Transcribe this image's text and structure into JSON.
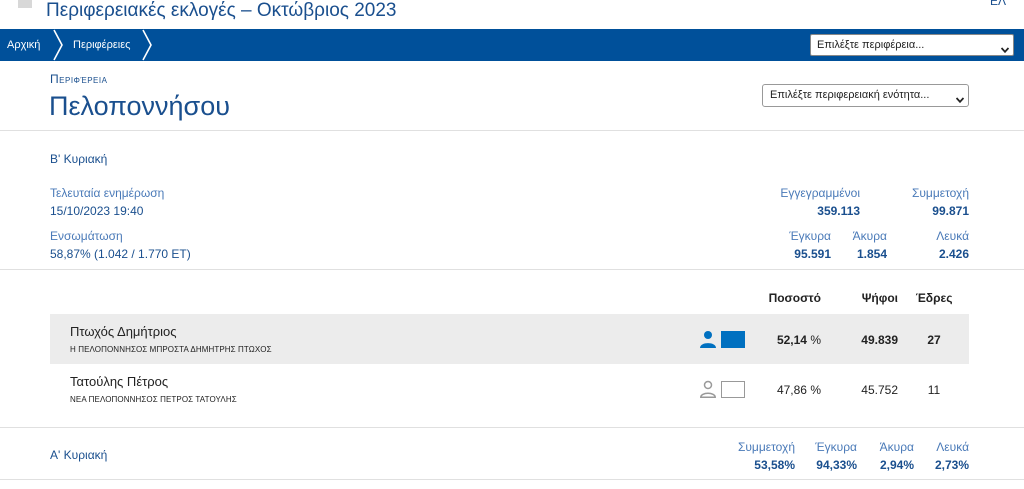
{
  "header": {
    "title": "Περιφερειακές εκλογές – Οκτώβριος 2023",
    "lang": "ΕΛ"
  },
  "breadcrumb": {
    "home": "Αρχική",
    "regions": "Περιφέρειες"
  },
  "region_select": {
    "value": "Επιλέξτε περιφέρεια..."
  },
  "region": {
    "label": "Περιφέρεια",
    "name": "Πελοποννήσου",
    "unit_select": "Επιλέξτε περιφερειακή ενότητα..."
  },
  "round_b": {
    "title": "Β' Κυριακή",
    "last_update_label": "Τελευταία ενημέρωση",
    "last_update_value": "15/10/2023 19:40",
    "integration_label": "Ενσωμάτωση",
    "integration_value": "58,87% (1.042 / 1.770 ΕΤ)",
    "registered_label": "Εγγεγραμμένοι",
    "registered_value": "359.113",
    "turnout_label": "Συμμετοχή",
    "turnout_value": "99.871",
    "valid_label": "Έγκυρα",
    "valid_value": "95.591",
    "invalid_label": "Άκυρα",
    "invalid_value": "1.854",
    "blank_label": "Λευκά",
    "blank_value": "2.426"
  },
  "results": {
    "headers": {
      "percent": "Ποσοστό",
      "votes": "Ψήφοι",
      "seats": "Έδρες"
    },
    "rows": [
      {
        "candidate": "Πτωχός Δημήτριος",
        "party": "Η ΠΕΛΟΠΟΝΝΗΣΟΣ ΜΠΡΟΣΤΑ ΔΗΜΗΤΡΗΣ ΠΤΩΧΟΣ",
        "percent": "52,14",
        "percent_sign": "%",
        "votes": "49.839",
        "seats": "27",
        "winner": true
      },
      {
        "candidate": "Τατούλης Πέτρος",
        "party": "ΝΕΑ ΠΕΛΟΠΟΝΝΗΣΟΣ ΠΕΤΡΟΣ ΤΑΤΟΥΛΗΣ",
        "percent": "47,86",
        "percent_sign": "%",
        "votes": "45.752",
        "seats": "11",
        "winner": false
      }
    ]
  },
  "round_a": {
    "title": "Α' Κυριακή",
    "turnout_label": "Συμμετοχή",
    "turnout_value": "53,58%",
    "valid_label": "Έγκυρα",
    "valid_value": "94,33%",
    "invalid_label": "Άκυρα",
    "invalid_value": "2,94%",
    "blank_label": "Λευκά",
    "blank_value": "2,73%"
  },
  "colors": {
    "nav_bg": "#00509a",
    "brand_text": "#1a4f8e",
    "label_text": "#4a7ab8",
    "winner_icon": "#0070c0",
    "loser_icon": "#999999",
    "row_highlight": "#ececec"
  },
  "icons": {
    "person": "person-icon",
    "seat_box": "seat-box-icon",
    "chevron": "chevron-down-icon",
    "breadcrumb_sep": "chevron-right-icon"
  }
}
